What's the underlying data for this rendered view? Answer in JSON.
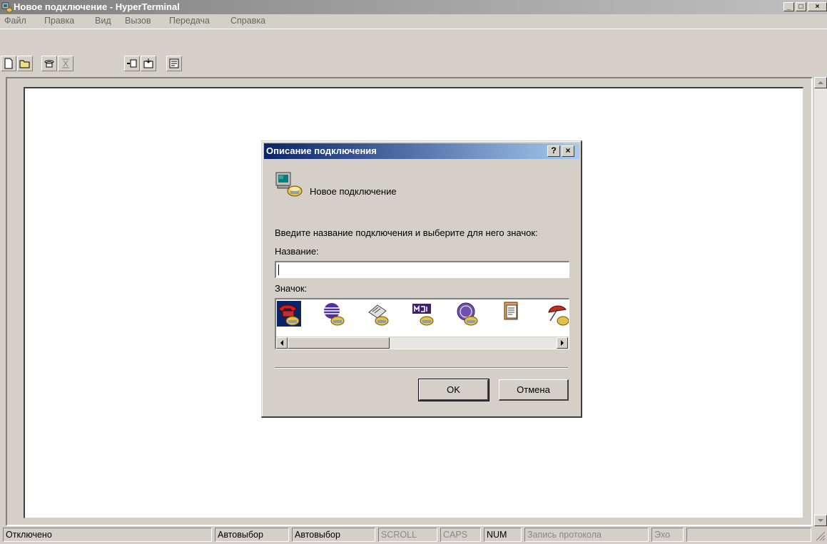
{
  "window": {
    "title": "Новое подключение - HyperTerminal"
  },
  "window_buttons": {
    "minimize": "_",
    "maximize": "□",
    "close": "×"
  },
  "menu": [
    "Файл",
    "Правка",
    "Вид",
    "Вызов",
    "Передача",
    "Справка"
  ],
  "toolbar": [
    {
      "icon": "new-file-icon"
    },
    {
      "icon": "open-folder-icon"
    },
    {
      "icon": "call-icon"
    },
    {
      "icon": "disconnect-icon"
    },
    {
      "icon": "send-icon"
    },
    {
      "icon": "receive-icon"
    },
    {
      "icon": "properties-icon"
    }
  ],
  "dialog": {
    "title": "Описание подключения",
    "help_button": "?",
    "close_button": "×",
    "connection_name": "Новое подключение",
    "prompt": "Введите название подключения и выберите для него значок:",
    "name_label": "Название:",
    "name_value": "",
    "icon_label": "Значок:",
    "icons": [
      "red-phone-icon",
      "globe-phone-icon",
      "fax-phone-icon",
      "mci-phone-icon",
      "ge-phone-icon",
      "documents-phone-icon",
      "umbrella-phone-icon"
    ],
    "selected_icon": 0,
    "ok_label": "OK",
    "cancel_label": "Отмена"
  },
  "status": [
    {
      "text": "Отключено",
      "enabled": true
    },
    {
      "text": "Автовыбор",
      "enabled": true
    },
    {
      "text": "Автовыбор",
      "enabled": true
    },
    {
      "text": "SCROLL",
      "enabled": false
    },
    {
      "text": "CAPS",
      "enabled": false
    },
    {
      "text": "NUM",
      "enabled": true
    },
    {
      "text": "Запись протокола",
      "enabled": false
    },
    {
      "text": "Эхо",
      "enabled": false
    }
  ],
  "colors": {
    "active_title": "#0a246a",
    "face": "#d4d0c8"
  }
}
